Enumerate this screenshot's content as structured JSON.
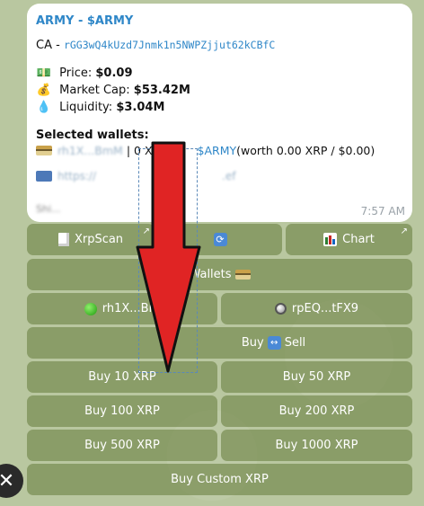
{
  "message": {
    "title": "ARMY - $ARMY",
    "ca_label": "CA -",
    "ca_value": "rGG3wQ4kUzd7Jnmk1n5NWPZjjut62kCBfC",
    "price_label": "Price:",
    "price_value": "$0.09",
    "mcap_label": "Market Cap:",
    "mcap_value": "$53.42M",
    "liq_label": "Liquidity:",
    "liq_value": "$3.04M",
    "selected_label": "Selected wallets:",
    "wallet_blurred": "rh1X...BmM",
    "wallet_sep": " | 0 X",
    "wallet_token": "$ARMY",
    "wallet_worth": " (worth 0.00 XRP / $0.00)",
    "http_blurred": "https://",
    "http_tail": ".ef",
    "bottom_blurred": "Shi...",
    "time": "7:57 AM"
  },
  "buttons": {
    "xrpscan": "XrpScan",
    "chart": "Chart",
    "wallets": "Wallets",
    "wallet1": "rh1X...Bm",
    "wallet2": "rpEQ...tFX9",
    "buy": "Buy",
    "sell": "Sell",
    "buy10": "Buy 10 XRP",
    "buy50": "Buy 50 XRP",
    "buy100": "Buy 100 XRP",
    "buy200": "Buy 200 XRP",
    "buy500": "Buy 500 XRP",
    "buy1000": "Buy 1000 XRP",
    "buycustom": "Buy Custom XRP",
    "corner_glyph": "↗"
  },
  "colors": {
    "link": "#2f87c8",
    "button_bg": "#6e8246",
    "arrow_fill": "#e02424",
    "background": "#b9c7a0"
  },
  "icons": {
    "price": "money-icon",
    "mcap": "money-bag-icon",
    "liquidity": "droplet-icon",
    "arrow": "red-down-arrow-icon"
  }
}
